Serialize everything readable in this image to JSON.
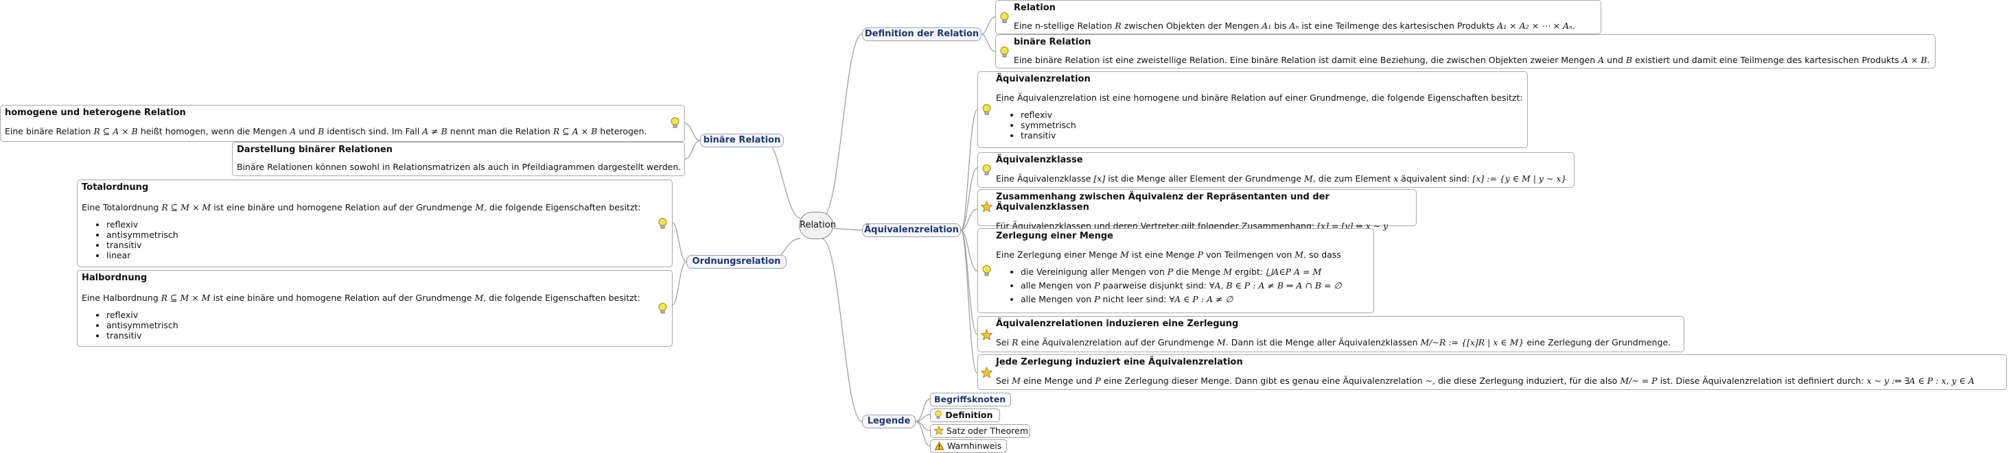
{
  "root": "Relation",
  "branches": {
    "definition": "Definition der Relation",
    "aequivalenz": "Äquivalenzrelation",
    "legende": "Legende",
    "binaer": "binäre Relation",
    "ordnung": "Ordnungsrelation"
  },
  "definition": {
    "relation": {
      "title": "Relation",
      "text_a": "Eine n-stellige Relation",
      "m_r": "R",
      "text_b": "zwischen Objekten der Mengen",
      "m_a1": "A₁",
      "text_c": "bis",
      "m_an": "Aₙ",
      "text_d": "ist eine Teilmenge des kartesischen Produkts",
      "m_prod": "A₁ × A₂ × ⋯ × Aₙ."
    },
    "binaer": {
      "title": "binäre Relation",
      "text_a": "Eine binäre Relation ist eine zweistellige Relation. Eine binäre Relation ist damit eine Beziehung, die zwischen Objekten zweier Mengen",
      "m_a": "A",
      "text_b": "und",
      "m_b": "B",
      "text_c": "existiert und damit eine Teilmenge des kartesischen Produkts",
      "m_prod": "A × B."
    }
  },
  "aequivalenz": {
    "relation": {
      "title": "Äquivalenzrelation",
      "text": "Eine Äquivalenzrelation ist eine homogene und binäre Relation auf einer Grundmenge, die folgende Eigenschaften besitzt:",
      "items": [
        "reflexiv",
        "symmetrisch",
        "transitiv"
      ]
    },
    "klasse": {
      "title": "Äquivalenzklasse",
      "text_a": "Eine Äquivalenzklasse",
      "m_x": "[x]",
      "text_b": "ist die Menge aller Element der Grundmenge",
      "m_m": "M,",
      "text_c": "die zum Element",
      "m_x2": "x",
      "text_d": "äquivalent sind:",
      "m_def": "[x] := {y ∈ M | y ∼ x}"
    },
    "zusammenhang": {
      "title": "Zusammenhang zwischen Äquivalenz der Repräsentanten und der Äquivalenzklassen",
      "text": "Für Äquivalenzklassen und deren Vertreter gilt folgender Zusammenhang:",
      "m_f": "[x] = [y] ⇔ x ∼ y"
    },
    "zerlegung": {
      "title": "Zerlegung einer Menge",
      "text_a": "Eine Zerlegung einer Menge",
      "m_m": "M",
      "text_b": "ist eine Menge",
      "m_p": "P",
      "text_c": "von Teilmengen von",
      "m_m2": "M,",
      "text_d": "so dass",
      "item1_text": "die Vereinigung aller Mengen von",
      "item1_p": "P",
      "item1_text2": "die Menge",
      "item1_m": "M",
      "item1_text3": "ergibt:",
      "item1_f": "⋃A∈P A = M",
      "item2_text": "alle Mengen von",
      "item2_p": "P",
      "item2_text2": "paarweise disjunkt sind:",
      "item2_f": "∀A, B ∈ P : A ≠ B ⇒ A ∩ B = ∅",
      "item3_text": "alle Mengen von",
      "item3_p": "P",
      "item3_text2": "nicht leer sind:",
      "item3_f": "∀A ∈ P : A ≠ ∅"
    },
    "induzieren": {
      "title": "Äquivalenzrelationen induzieren eine Zerlegung",
      "text_a": "Sei",
      "m_r": "R",
      "text_b": "eine Äquivalenzrelation auf der Grundmenge",
      "m_m": "M.",
      "text_c": "Dann ist die Menge aller Äquivalenzklassen",
      "m_f": "M/∼R := {[x]R | x ∈ M}",
      "text_d": "eine Zerlegung der Grundmenge."
    },
    "jede": {
      "title": "Jede Zerlegung induziert eine Äquivalenzrelation",
      "text_a": "Sei",
      "m_m": "M",
      "text_b": "eine Menge und",
      "m_p": "P",
      "text_c": "eine Zerlegung dieser Menge. Dann gibt es genau eine Äquivalenzrelation",
      "m_sim": "∼,",
      "text_d": "die diese Zerlegung induziert, für die also",
      "m_f": "M/∼ = P",
      "text_e": "ist. Diese Äquivalenzrelation ist definiert durch:",
      "m_f2": "x ∼ y :⇔ ∃A ∈ P : x, y ∈ A"
    }
  },
  "binaer": {
    "homogen": {
      "title": "homogene und heterogene Relation",
      "text_a": "Eine binäre Relation",
      "m_r": "R ⊆ A × B",
      "text_b": "heißt homogen, wenn die Mengen",
      "m_a": "A",
      "text_c": "und",
      "m_b": "B",
      "text_d": "identisch sind. Im Fall",
      "m_neq": "A ≠ B",
      "text_e": "nennt man die Relation",
      "m_r2": "R ⊆ A × B",
      "text_f": "heterogen."
    },
    "darstellung": {
      "title": "Darstellung binärer Relationen",
      "text": "Binäre Relationen können sowohl in Relationsmatrizen als auch in Pfeildiagrammen dargestellt werden."
    }
  },
  "ordnung": {
    "total": {
      "title": "Totalordnung",
      "text_a": "Eine Totalordnung",
      "m_r": "R ⊆ M × M",
      "text_b": "ist eine binäre und homogene Relation auf der Grundmenge",
      "m_m": "M,",
      "text_c": "die folgende Eigenschaften besitzt:",
      "items": [
        "reflexiv",
        "antisymmetrisch",
        "transitiv",
        "linear"
      ]
    },
    "halb": {
      "title": "Halbordnung",
      "text_a": "Eine Halbordnung",
      "m_r": "R ⊆ M × M",
      "text_b": "ist eine binäre und homogene Relation auf der Grundmenge",
      "m_m": "M,",
      "text_c": "die folgende Eigenschaften besitzt:",
      "items": [
        "reflexiv",
        "antisymmetrisch",
        "transitiv"
      ]
    }
  },
  "legende": {
    "begriff": "Begriffsknoten",
    "definition": "Definition",
    "satz": "Satz oder Theorem",
    "warn": "Warnhinweis"
  },
  "colors": {
    "link": "#9a9a9a",
    "node_text": "#1f3770",
    "bulb": "#f4e64a",
    "star": "#f3c531",
    "warn": "#f0b31a"
  }
}
